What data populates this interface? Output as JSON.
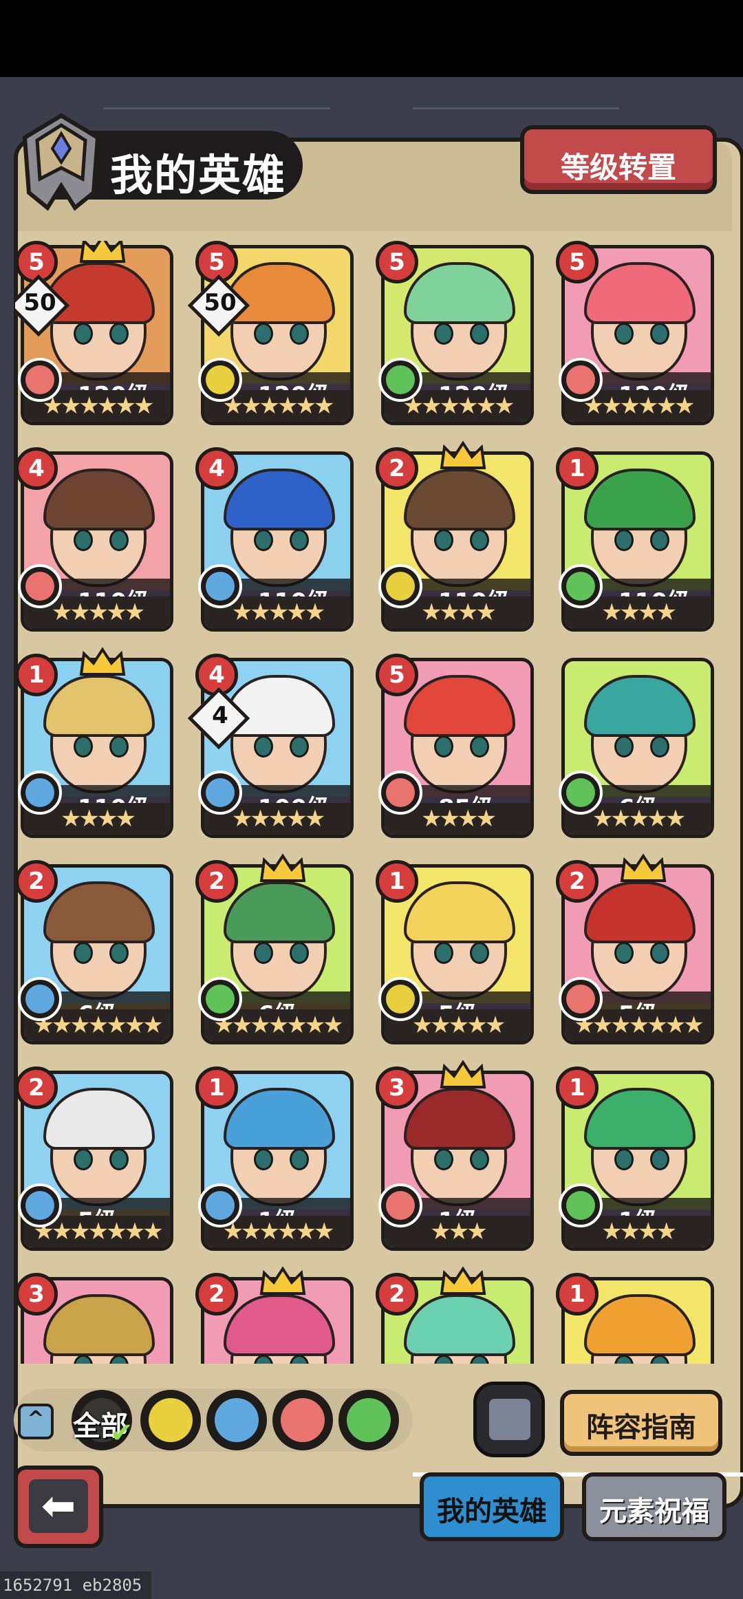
{
  "page": {
    "title": "我的英雄",
    "reset_button": "等级转置",
    "guide_button": "阵容指南",
    "tabs": [
      {
        "label": "我的英雄",
        "active": true
      },
      {
        "label": "元素祝福",
        "active": false
      }
    ],
    "filter": {
      "all_label": "全部",
      "selected": "all",
      "elements": [
        "earth",
        "water",
        "fire",
        "wind"
      ]
    },
    "build_id": "1652791 eb2805"
  },
  "colors": {
    "fire": "#e9736e",
    "water": "#5fa8e0",
    "earth": "#e8cf3e",
    "wind": "#5fc35a",
    "purple_card": "#b89be4",
    "gold_card": "#e6c06a"
  },
  "heroes": [
    {
      "rank": "5",
      "level": "120级",
      "element": "fire",
      "stars": 6,
      "crown": true,
      "badge": "50",
      "card": "purple",
      "bg": "#e49c5a",
      "hair": "#c73b2e"
    },
    {
      "rank": "5",
      "level": "120级",
      "element": "earth",
      "stars": 6,
      "crown": false,
      "badge": "50",
      "card": "purple",
      "bg": "#f2d86b",
      "hair": "#e98a3b"
    },
    {
      "rank": "5",
      "level": "120级",
      "element": "wind",
      "stars": 6,
      "crown": false,
      "badge": "",
      "card": "purple",
      "bg": "#d3e86c",
      "hair": "#7fd29a"
    },
    {
      "rank": "5",
      "level": "120级",
      "element": "fire",
      "stars": 6,
      "crown": false,
      "badge": "",
      "card": "purple",
      "bg": "#f29bb5",
      "hair": "#ef6b7a"
    },
    {
      "rank": "4",
      "level": "110级",
      "element": "fire",
      "stars": 5,
      "crown": false,
      "badge": "",
      "card": "purple",
      "bg": "#f3a3a8",
      "hair": "#6e4433"
    },
    {
      "rank": "4",
      "level": "110级",
      "element": "water",
      "stars": 5,
      "crown": false,
      "badge": "",
      "card": "purple",
      "bg": "#8cd0f0",
      "hair": "#2e62c9"
    },
    {
      "rank": "2",
      "level": "110级",
      "element": "earth",
      "stars": 4,
      "crown": true,
      "badge": "",
      "card": "purple",
      "bg": "#f3e46a",
      "hair": "#6a4a33"
    },
    {
      "rank": "1",
      "level": "110级",
      "element": "wind",
      "stars": 4,
      "crown": false,
      "badge": "",
      "card": "purple",
      "bg": "#c9ec70",
      "hair": "#3aa24a"
    },
    {
      "rank": "1",
      "level": "110级",
      "element": "water",
      "stars": 4,
      "crown": true,
      "badge": "",
      "card": "purple",
      "bg": "#8cd0f0",
      "hair": "#e2c26a"
    },
    {
      "rank": "4",
      "level": "100级",
      "element": "water",
      "stars": 5,
      "crown": false,
      "badge": "4",
      "card": "purple",
      "bg": "#8fd1f0",
      "hair": "#f2f2f2"
    },
    {
      "rank": "5",
      "level": "85级",
      "element": "fire",
      "stars": 4,
      "crown": false,
      "badge": "",
      "card": "purple",
      "bg": "#f29bb5",
      "hair": "#e2463a"
    },
    {
      "rank": "",
      "level": "6级",
      "element": "wind",
      "stars": 5,
      "crown": false,
      "badge": "",
      "card": "purple",
      "bg": "#c9ec70",
      "hair": "#3aa6a0"
    },
    {
      "rank": "2",
      "level": "6级",
      "element": "water",
      "stars": 7,
      "crown": false,
      "badge": "",
      "card": "gold",
      "bg": "#8fd1f0",
      "hair": "#8a5a3a"
    },
    {
      "rank": "2",
      "level": "6级",
      "element": "wind",
      "stars": 7,
      "crown": true,
      "badge": "",
      "card": "gold",
      "bg": "#c9ec70",
      "hair": "#4a9a5a"
    },
    {
      "rank": "1",
      "level": "5级",
      "element": "earth",
      "stars": 5,
      "crown": false,
      "badge": "",
      "card": "purple",
      "bg": "#f3e46a",
      "hair": "#f2d25a"
    },
    {
      "rank": "2",
      "level": "5级",
      "element": "fire",
      "stars": 7,
      "crown": true,
      "badge": "",
      "card": "gold",
      "bg": "#f29bb5",
      "hair": "#c7342e"
    },
    {
      "rank": "2",
      "level": "5级",
      "element": "water",
      "stars": 7,
      "crown": false,
      "badge": "",
      "card": "gold",
      "bg": "#8fd1f0",
      "hair": "#e9e9ea"
    },
    {
      "rank": "1",
      "level": "1级",
      "element": "water",
      "stars": 6,
      "crown": false,
      "badge": "",
      "card": "purple",
      "bg": "#8fd1f0",
      "hair": "#4aa0d8"
    },
    {
      "rank": "3",
      "level": "1级",
      "element": "fire",
      "stars": 3,
      "crown": true,
      "badge": "",
      "card": "purple",
      "bg": "#f29bb5",
      "hair": "#9a2a2a"
    },
    {
      "rank": "1",
      "level": "1级",
      "element": "wind",
      "stars": 4,
      "crown": false,
      "badge": "",
      "card": "purple",
      "bg": "#c9ec70",
      "hair": "#3ab06a"
    },
    {
      "rank": "3",
      "level": "",
      "element": "",
      "stars": 0,
      "crown": false,
      "badge": "",
      "card": "gold",
      "bg": "#f29bb5",
      "hair": "#c9a24a"
    },
    {
      "rank": "2",
      "level": "",
      "element": "",
      "stars": 0,
      "crown": true,
      "badge": "",
      "card": "gold",
      "bg": "#f29bb5",
      "hair": "#e05a8a"
    },
    {
      "rank": "2",
      "level": "",
      "element": "",
      "stars": 0,
      "crown": true,
      "badge": "",
      "card": "purple",
      "bg": "#c9ec70",
      "hair": "#6ad0b0"
    },
    {
      "rank": "1",
      "level": "",
      "element": "",
      "stars": 0,
      "crown": false,
      "badge": "",
      "card": "gold",
      "bg": "#f3e46a",
      "hair": "#f0a030"
    }
  ]
}
